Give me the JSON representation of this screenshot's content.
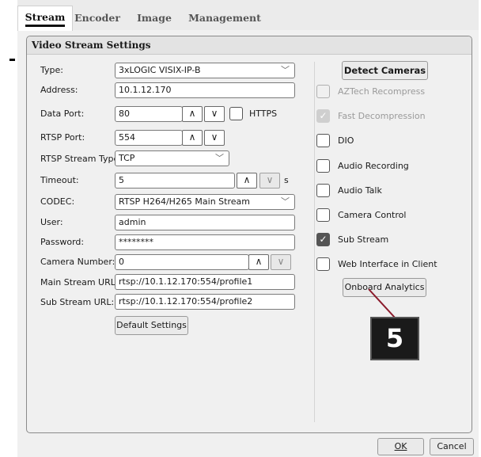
{
  "tabs": [
    {
      "label": "Stream",
      "active": true
    },
    {
      "label": "Encoder"
    },
    {
      "label": "Image"
    },
    {
      "label": "Management"
    }
  ],
  "section_title": "Video Stream Settings",
  "fields": {
    "type": {
      "label": "Type:",
      "value": "3xLOGIC VISIX-IP-B"
    },
    "address": {
      "label": "Address:",
      "value": "10.1.12.170"
    },
    "data_port": {
      "label": "Data Port:",
      "value": "80"
    },
    "https": {
      "label": "HTTPS",
      "checked": false
    },
    "rtsp_port": {
      "label": "RTSP Port:",
      "value": "554"
    },
    "rtsp_stream_type": {
      "label": "RTSP Stream Type:",
      "value": "TCP"
    },
    "timeout": {
      "label": "Timeout:",
      "value": "5",
      "unit": "s"
    },
    "codec": {
      "label": "CODEC:",
      "value": "RTSP H264/H265 Main Stream"
    },
    "user": {
      "label": "User:",
      "value": "admin"
    },
    "password": {
      "label": "Password:",
      "value": "********"
    },
    "camera_number": {
      "label": "Camera Number:",
      "value": "0"
    },
    "main_stream_url": {
      "label": "Main Stream URL:",
      "value": "rtsp://10.1.12.170:554/profile1"
    },
    "sub_stream_url": {
      "label": "Sub Stream URL:",
      "value": "rtsp://10.1.12.170:554/profile2"
    }
  },
  "buttons": {
    "default_settings": "Default Settings",
    "detect_cameras": "Detect Cameras",
    "onboard_analytics": "Onboard Analytics",
    "ok": "OK",
    "cancel": "Cancel"
  },
  "options": [
    {
      "label": "AZTech Recompress",
      "checked": false,
      "disabled": true
    },
    {
      "label": "Fast Decompression",
      "checked": true,
      "disabled": true
    },
    {
      "label": "DIO",
      "checked": false,
      "disabled": false
    },
    {
      "label": "Audio Recording",
      "checked": false,
      "disabled": false
    },
    {
      "label": "Audio Talk",
      "checked": false,
      "disabled": false
    },
    {
      "label": "Camera Control",
      "checked": false,
      "disabled": false
    },
    {
      "label": "Sub Stream",
      "checked": true,
      "disabled": false
    },
    {
      "label": "Web Interface in Client",
      "checked": false,
      "disabled": false
    }
  ],
  "annotation": {
    "number": "5"
  },
  "glyphs": {
    "up": "∧",
    "down": "∨",
    "check": "✓"
  },
  "colors": {
    "marker_bg": "#1a1a1a",
    "marker_line": "#8b1a2b"
  }
}
